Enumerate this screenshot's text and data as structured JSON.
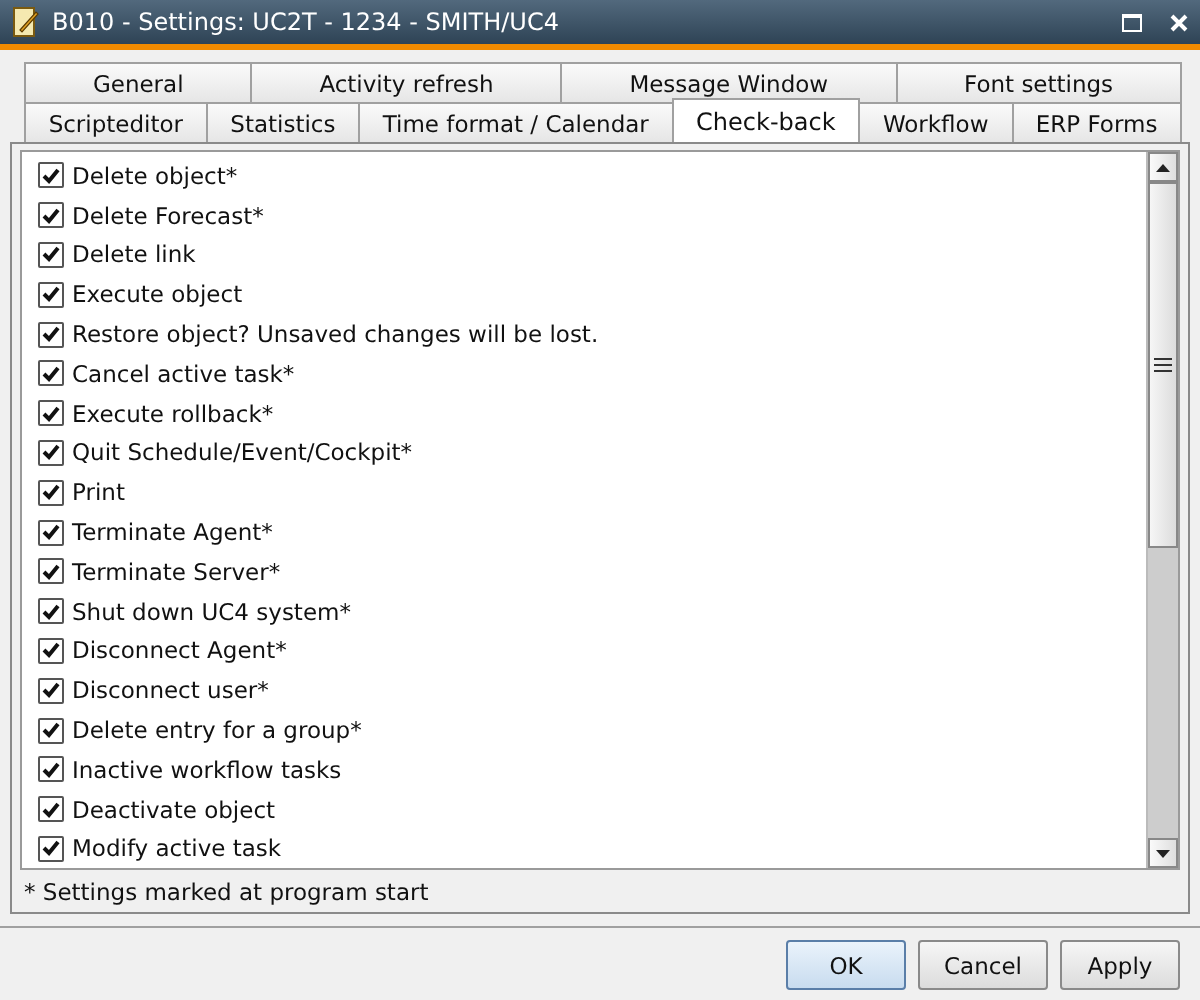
{
  "window": {
    "title": "B010 - Settings: UC2T - 1234 - SMITH/UC4"
  },
  "tabs": [
    [
      {
        "label": "General",
        "selected": false
      },
      {
        "label": "Activity refresh",
        "selected": false
      },
      {
        "label": "Message Window",
        "selected": false
      },
      {
        "label": "Font settings",
        "selected": false
      }
    ],
    [
      {
        "label": "Scripteditor",
        "selected": false
      },
      {
        "label": "Statistics",
        "selected": false
      },
      {
        "label": "Time format / Calendar",
        "selected": false
      },
      {
        "label": "Check-back",
        "selected": true
      },
      {
        "label": "Workflow",
        "selected": false
      },
      {
        "label": "ERP Forms",
        "selected": false
      }
    ]
  ],
  "options": [
    {
      "label": "Delete object*",
      "checked": true
    },
    {
      "label": "Delete Forecast*",
      "checked": true
    },
    {
      "label": "Delete link",
      "checked": true
    },
    {
      "label": "Execute object",
      "checked": true
    },
    {
      "label": "Restore object? Unsaved changes will be lost.",
      "checked": true
    },
    {
      "label": "Cancel active task*",
      "checked": true
    },
    {
      "label": "Execute rollback*",
      "checked": true
    },
    {
      "label": "Quit Schedule/Event/Cockpit*",
      "checked": true
    },
    {
      "label": "Print",
      "checked": true
    },
    {
      "label": "Terminate Agent*",
      "checked": true
    },
    {
      "label": "Terminate Server*",
      "checked": true
    },
    {
      "label": "Shut down UC4 system*",
      "checked": true
    },
    {
      "label": "Disconnect Agent*",
      "checked": true
    },
    {
      "label": "Disconnect user*",
      "checked": true
    },
    {
      "label": "Delete entry for a group*",
      "checked": true
    },
    {
      "label": "Inactive workflow tasks",
      "checked": true
    },
    {
      "label": "Deactivate object",
      "checked": true
    },
    {
      "label": "Modify active task",
      "checked": true
    }
  ],
  "footnote": "* Settings marked at program start",
  "buttons": [
    {
      "label": "OK",
      "default": true
    },
    {
      "label": "Cancel",
      "default": false
    },
    {
      "label": "Apply",
      "default": false
    }
  ]
}
